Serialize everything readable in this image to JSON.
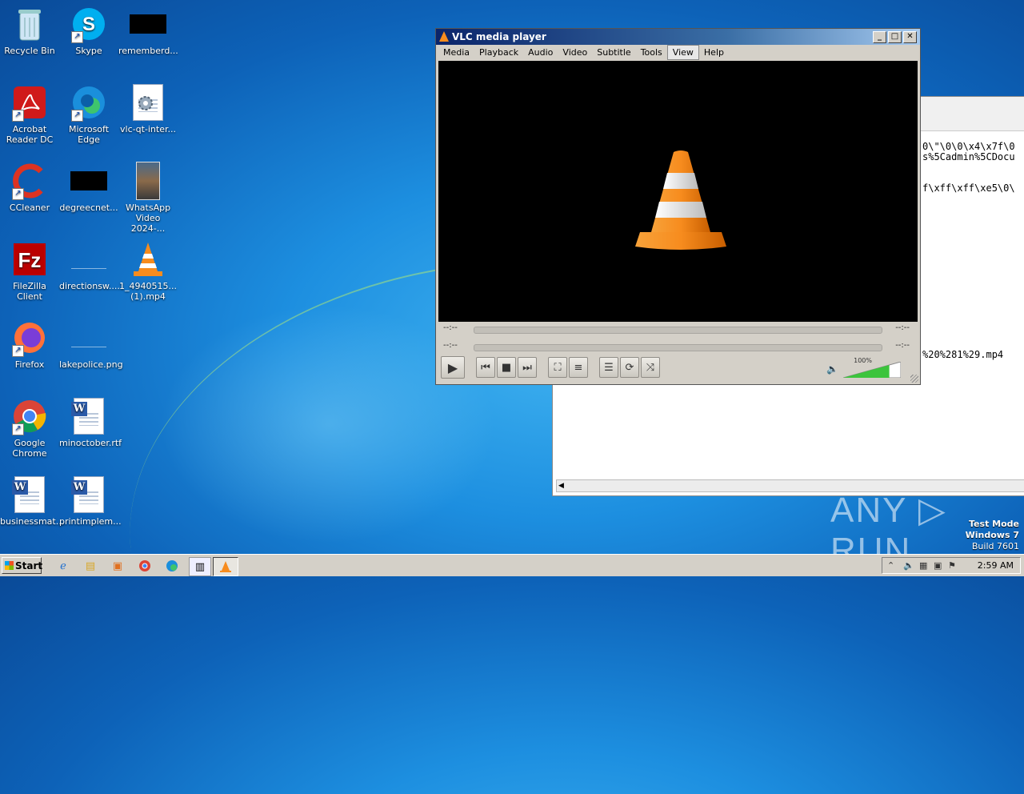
{
  "desktop": {
    "icons": [
      {
        "label": "Recycle Bin"
      },
      {
        "label": "Skype"
      },
      {
        "label": "rememberd..."
      },
      {
        "label": "Acrobat Reader DC"
      },
      {
        "label": "Microsoft Edge"
      },
      {
        "label": "vlc-qt-inter..."
      },
      {
        "label": "CCleaner"
      },
      {
        "label": "degreecnet..."
      },
      {
        "label": "WhatsApp Video 2024-..."
      },
      {
        "label": "FileZilla Client"
      },
      {
        "label": "directionsw...."
      },
      {
        "label": "1_4940515... (1).mp4"
      },
      {
        "label": "Firefox"
      },
      {
        "label": "lakepolice.png"
      },
      {
        "label": "Google Chrome"
      },
      {
        "label": "minoctober.rtf"
      },
      {
        "label": "businessmat..."
      },
      {
        "label": "printimplem..."
      }
    ]
  },
  "background_window": {
    "lines": [
      "0\\\"\\0\\0\\x4\\x7f\\0",
      "s%5Cadmin%5CDocu",
      "f\\xff\\xff\\xe5\\0\\",
      "%20%281%29.mp4"
    ]
  },
  "vlc": {
    "title": "VLC media player",
    "window_buttons": {
      "minimize": "_",
      "maximize": "□",
      "close": "✕"
    },
    "menu": [
      "Media",
      "Playback",
      "Audio",
      "Video",
      "Subtitle",
      "Tools",
      "View",
      "Help"
    ],
    "active_menu": "View",
    "time_left": "--:--",
    "time_right": "--:--",
    "time_left2": "--:--",
    "time_right2": "--:--",
    "volume": "100%",
    "volume_level": 1.0
  },
  "watermark": {
    "text": "ANY ▷ RUN"
  },
  "os_info": {
    "line1": "Test Mode",
    "line2": "Windows 7",
    "line3": "Build 7601"
  },
  "taskbar": {
    "start": "Start",
    "clock": "2:59 AM",
    "tray_icons": [
      "chevron-up-icon",
      "speaker-icon",
      "network-icon",
      "action-center-icon",
      "flag-icon"
    ]
  },
  "colors": {
    "vlc_orange": "#f78c1e",
    "volume_green": "#3cc43c"
  }
}
